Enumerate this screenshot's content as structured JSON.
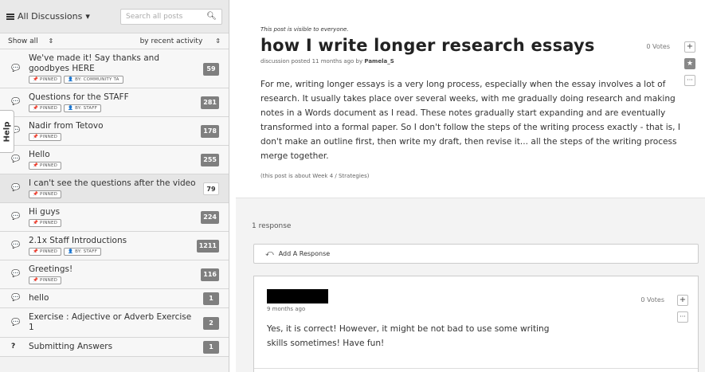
{
  "sidebar": {
    "menu_label": "All Discussions",
    "search_placeholder": "Search all posts",
    "filter_label": "Show all",
    "sort_label": "by recent activity",
    "help_label": "Help",
    "threads": [
      {
        "title": "We've made it! Say thanks and goodbyes HERE",
        "icon": "comment-icon",
        "badges": [
          "📌 PINNED",
          "👤 BY: COMMUNITY TA"
        ],
        "count": "59",
        "selected": false
      },
      {
        "title": "Questions for the STAFF",
        "icon": "comment-icon",
        "badges": [
          "📌 PINNED",
          "👤 BY: STAFF"
        ],
        "count": "281",
        "selected": false
      },
      {
        "title": "Nadir from Tetovo",
        "icon": "comment-icon",
        "badges": [
          "📌 PINNED"
        ],
        "count": "178",
        "selected": false
      },
      {
        "title": "Hello",
        "icon": "comment-icon",
        "badges": [
          "📌 PINNED"
        ],
        "count": "255",
        "selected": false
      },
      {
        "title": "I can't see the questions after the video",
        "icon": "comment-icon",
        "badges": [
          "📌 PINNED"
        ],
        "count": "79",
        "selected": true
      },
      {
        "title": "Hi guys",
        "icon": "comment-icon",
        "badges": [
          "📌 PINNED"
        ],
        "count": "224",
        "selected": false
      },
      {
        "title": "2.1x Staff Introductions",
        "icon": "comment-icon",
        "badges": [
          "📌 PINNED",
          "👤 BY: STAFF"
        ],
        "count": "1211",
        "selected": false
      },
      {
        "title": "Greetings!",
        "icon": "comment-icon",
        "badges": [
          "📌 PINNED"
        ],
        "count": "116",
        "selected": false
      },
      {
        "title": "hello",
        "icon": "comment-icon",
        "badges": [],
        "count": "1",
        "selected": false
      },
      {
        "title": "Exercise : Adjective or Adverb Exercise 1",
        "icon": "comment-icon",
        "badges": [],
        "count": "2",
        "selected": false
      },
      {
        "title": "Submitting Answers",
        "icon": "question-icon",
        "badges": [],
        "count": "1",
        "selected": false
      }
    ]
  },
  "post": {
    "visibility": "This post is visible to everyone.",
    "title": "how I write longer research essays",
    "meta_prefix": "discussion posted 11 months ago by",
    "author": "Pamela_S",
    "votes": "0 Votes",
    "body": "For me, writing longer essays is a very long process, especially when the essay involves a lot of research. It usually takes place over several weeks, with me gradually doing research and making notes in a Words document as I read. These notes gradually start expanding and are eventually transformed into a formal paper. So I don't follow the steps of the writing process exactly - that is, I don't make an outline first, then write my draft, then revise it... all the steps of the writing process merge together.",
    "topic": "(this post is about Week 4 / Strategies)"
  },
  "responses": {
    "count_label": "1 response",
    "add_label": "Add A Response",
    "items": [
      {
        "date": "9 months ago",
        "votes": "0 Votes",
        "body": "Yes, it is correct! However, it might be not bad to use some writing skills sometimes! Have fun!"
      }
    ]
  }
}
